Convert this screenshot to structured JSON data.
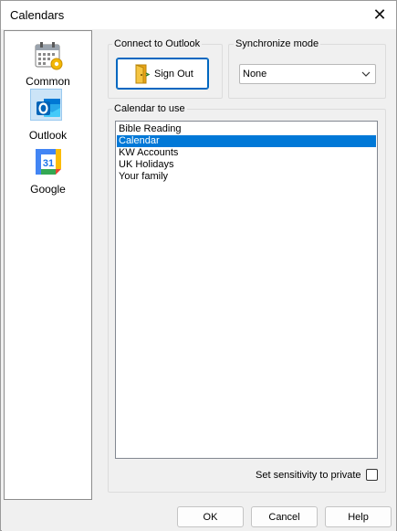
{
  "window": {
    "title": "Calendars"
  },
  "sidebar": {
    "items": [
      {
        "label": "Common",
        "icon": "calendar-gear-icon"
      },
      {
        "label": "Outlook",
        "icon": "outlook-icon",
        "selected": true
      },
      {
        "label": "Google",
        "icon": "google-calendar-icon"
      }
    ]
  },
  "connect": {
    "title": "Connect to Outlook",
    "button_label": "Sign Out",
    "button_icon": "door-exit-icon"
  },
  "sync": {
    "title": "Synchronize mode",
    "selected": "None"
  },
  "calendars": {
    "title": "Calendar to use",
    "items": [
      "Bible Reading",
      "Calendar",
      "KW Accounts",
      "UK Holidays",
      "Your family"
    ],
    "selected_index": 1
  },
  "sensitivity": {
    "label": "Set sensitivity to private",
    "checked": false
  },
  "buttons": {
    "ok": "OK",
    "cancel": "Cancel",
    "help": "Help"
  },
  "colors": {
    "selection": "#0078d7",
    "accent": "#0067c0"
  }
}
